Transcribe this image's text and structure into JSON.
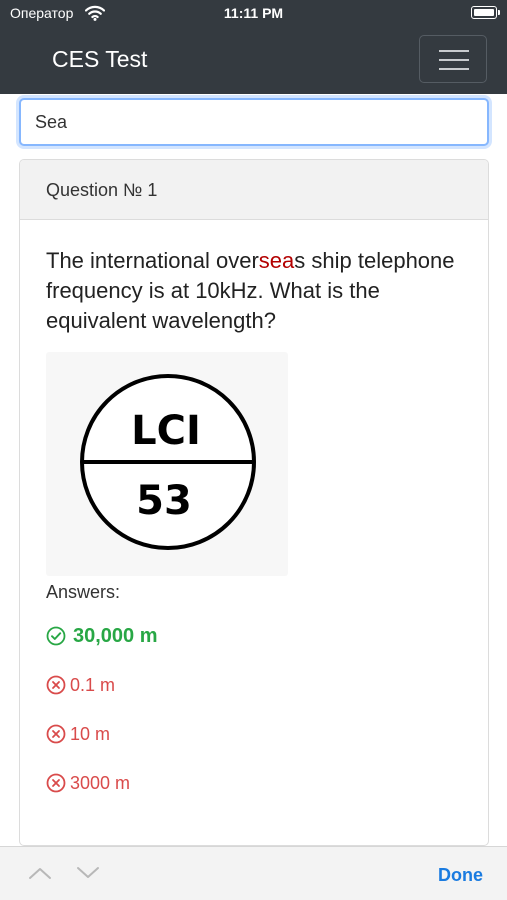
{
  "status_bar": {
    "carrier": "Оператор",
    "time": "11:11 PM"
  },
  "navbar": {
    "title": "CES Test"
  },
  "search": {
    "value": "Sea"
  },
  "question": {
    "header": "Question № 1",
    "text_before": "The international over",
    "text_highlight": "sea",
    "text_after": "s ship telephone frequency is at 10kHz. What is the equivalent wavelength?",
    "image": {
      "top_text": "LCI",
      "bottom_text": "53"
    }
  },
  "answers": {
    "label": "Answers:",
    "correct": "30,000 m",
    "wrong": [
      "0.1 m",
      "10 m",
      "3000 m"
    ]
  },
  "bottom_bar": {
    "done_label": "Done"
  },
  "colors": {
    "navbar": "#343a40",
    "correct": "#28a745",
    "wrong": "#d94b4b",
    "highlight": "#b30000",
    "done": "#1a7be0"
  }
}
